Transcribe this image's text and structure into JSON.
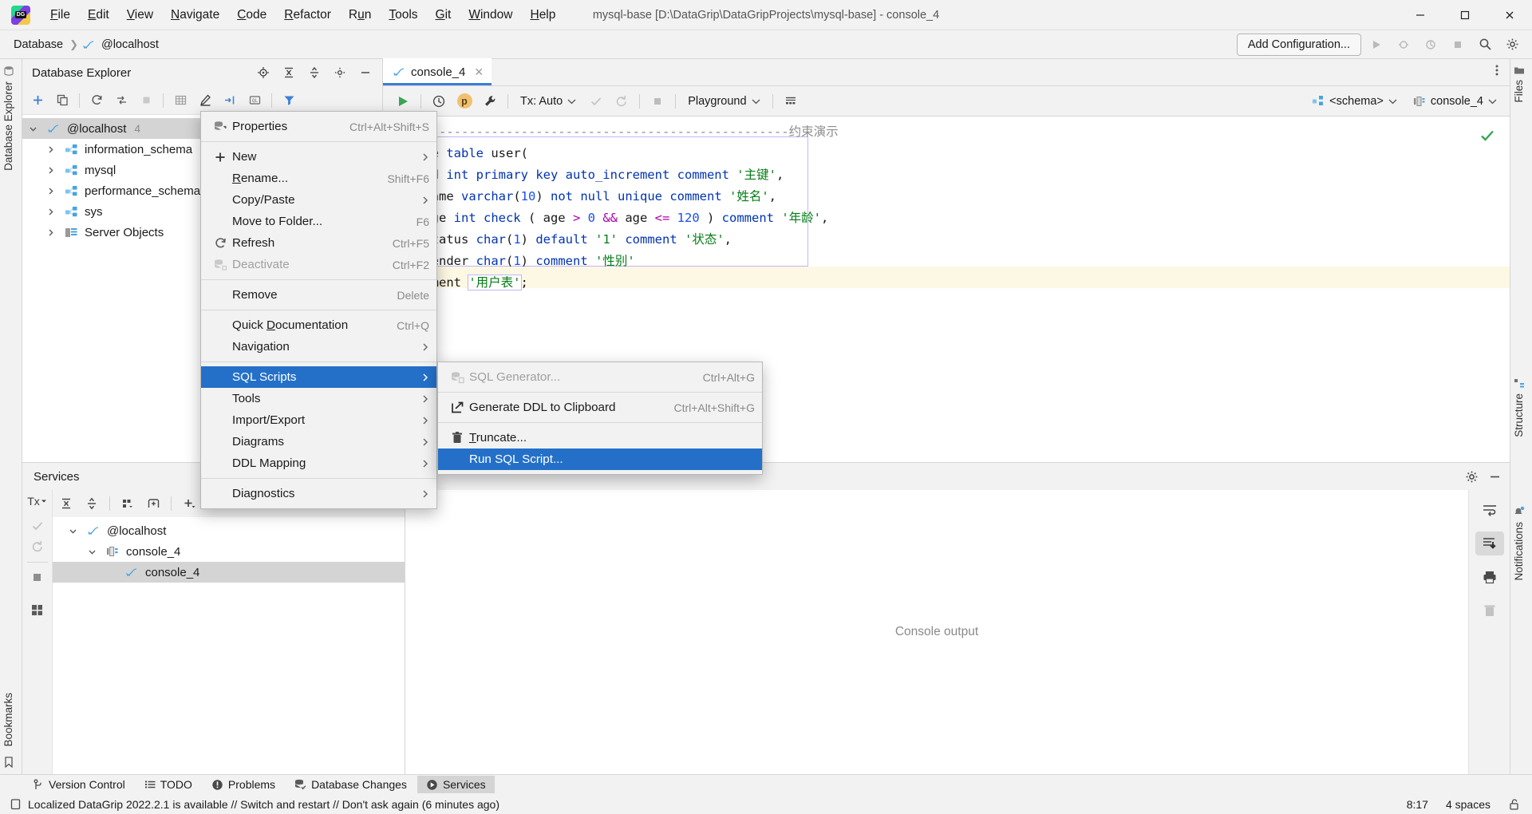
{
  "window": {
    "title": "mysql-base [D:\\DataGrip\\DataGripProjects\\mysql-base] - console_4",
    "minimize": "–",
    "maximize": "▢",
    "close": "✕"
  },
  "menubar": [
    {
      "label": "File"
    },
    {
      "label": "Edit"
    },
    {
      "label": "View"
    },
    {
      "label": "Navigate"
    },
    {
      "label": "Code"
    },
    {
      "label": "Refactor"
    },
    {
      "label": "Run"
    },
    {
      "label": "Tools"
    },
    {
      "label": "Git"
    },
    {
      "label": "Window"
    },
    {
      "label": "Help"
    }
  ],
  "navbar": {
    "crumbs": [
      "Database",
      "@localhost"
    ],
    "separator": "❯",
    "add_configuration": "Add Configuration..."
  },
  "left_strip": {
    "label": "Database Explorer",
    "bookmarks": "Bookmarks"
  },
  "right_strip": {
    "files": "Files",
    "structure": "Structure",
    "notifications": "Notifications"
  },
  "db_explorer": {
    "title": "Database Explorer",
    "tree": [
      {
        "label": "@localhost",
        "badge": "4",
        "icon": "mysql-dolphin-icon",
        "depth": 0,
        "expanded": true,
        "selected": true
      },
      {
        "label": "information_schema",
        "badge": "",
        "icon": "schema-icon",
        "depth": 1,
        "expanded": false,
        "selected": false
      },
      {
        "label": "mysql",
        "badge": "",
        "icon": "schema-icon",
        "depth": 1,
        "expanded": false,
        "selected": false
      },
      {
        "label": "performance_schema",
        "badge": "",
        "icon": "schema-icon",
        "depth": 1,
        "expanded": false,
        "selected": false
      },
      {
        "label": "sys",
        "badge": "",
        "icon": "schema-icon",
        "depth": 1,
        "expanded": false,
        "selected": false
      },
      {
        "label": "Server Objects",
        "badge": "",
        "icon": "server-objects-icon",
        "depth": 1,
        "expanded": false,
        "selected": false
      }
    ]
  },
  "editor": {
    "tab": {
      "label": "console_4",
      "icon": "mysql-dolphin-icon",
      "close": "✕"
    },
    "toolbar": {
      "run": "run-icon",
      "history": "history-icon",
      "profile": "p",
      "wrench": "wrench-icon",
      "tx_label": "Tx: Auto",
      "commit": "commit-icon",
      "rollback": "rollback-icon",
      "stop": "stop-icon",
      "schema_switcher": "Playground",
      "grid_icon": "data-grid-icon",
      "schema_selector": "<schema>",
      "session_selector": "console_4"
    },
    "code_lines": [
      {
        "tokens": [
          {
            "t": "-- --------------------------------------------------约束演示",
            "c": "cmt"
          }
        ]
      },
      {
        "tokens": [
          {
            "t": "create ",
            "c": "kw"
          },
          {
            "t": "table ",
            "c": "kw"
          },
          {
            "t": "user(",
            "c": "plain"
          }
        ]
      },
      {
        "tokens": [
          {
            "t": "    id ",
            "c": "plain"
          },
          {
            "t": "int ",
            "c": "kw"
          },
          {
            "t": "primary ",
            "c": "kw"
          },
          {
            "t": "key ",
            "c": "kw"
          },
          {
            "t": "auto_increment ",
            "c": "kw"
          },
          {
            "t": "comment ",
            "c": "kw"
          },
          {
            "t": "'主键'",
            "c": "str"
          },
          {
            "t": ",",
            "c": "plain"
          }
        ]
      },
      {
        "tokens": [
          {
            "t": "    name ",
            "c": "plain"
          },
          {
            "t": "varchar",
            "c": "kw"
          },
          {
            "t": "(",
            "c": "plain"
          },
          {
            "t": "10",
            "c": "num"
          },
          {
            "t": ") ",
            "c": "plain"
          },
          {
            "t": "not ",
            "c": "kw"
          },
          {
            "t": "null ",
            "c": "kw"
          },
          {
            "t": "unique ",
            "c": "kw"
          },
          {
            "t": "comment ",
            "c": "kw"
          },
          {
            "t": "'姓名'",
            "c": "str"
          },
          {
            "t": ",",
            "c": "plain"
          }
        ]
      },
      {
        "tokens": [
          {
            "t": "    age ",
            "c": "plain"
          },
          {
            "t": "int ",
            "c": "kw"
          },
          {
            "t": "check ",
            "c": "kw"
          },
          {
            "t": "( age ",
            "c": "plain"
          },
          {
            "t": "> ",
            "c": "op"
          },
          {
            "t": "0 ",
            "c": "num"
          },
          {
            "t": "&& ",
            "c": "op"
          },
          {
            "t": "age ",
            "c": "plain"
          },
          {
            "t": "<= ",
            "c": "op"
          },
          {
            "t": "120 ",
            "c": "num"
          },
          {
            "t": ") ",
            "c": "plain"
          },
          {
            "t": "comment ",
            "c": "kw"
          },
          {
            "t": "'年龄'",
            "c": "str"
          },
          {
            "t": ",",
            "c": "plain"
          }
        ]
      },
      {
        "tokens": [
          {
            "t": "    status ",
            "c": "plain"
          },
          {
            "t": "char",
            "c": "kw"
          },
          {
            "t": "(",
            "c": "plain"
          },
          {
            "t": "1",
            "c": "num"
          },
          {
            "t": ") ",
            "c": "plain"
          },
          {
            "t": "default ",
            "c": "kw"
          },
          {
            "t": "'1' ",
            "c": "str"
          },
          {
            "t": "comment ",
            "c": "kw"
          },
          {
            "t": "'状态'",
            "c": "str"
          },
          {
            "t": ",",
            "c": "plain"
          }
        ]
      },
      {
        "tokens": [
          {
            "t": "    gender ",
            "c": "plain"
          },
          {
            "t": "char",
            "c": "kw"
          },
          {
            "t": "(",
            "c": "plain"
          },
          {
            "t": "1",
            "c": "num"
          },
          {
            "t": ") ",
            "c": "plain"
          },
          {
            "t": "comment ",
            "c": "kw"
          },
          {
            "t": "'性别'",
            "c": "str"
          }
        ]
      },
      {
        "tokens": [
          {
            "t": ") comment ",
            "c": "plain"
          },
          {
            "t": "'用户表'",
            "c": "str"
          },
          {
            "t": ";",
            "c": "plain"
          }
        ]
      }
    ]
  },
  "context_menu": [
    {
      "type": "item",
      "label": "Properties",
      "shortcut": "Ctrl+Alt+Shift+S",
      "icon": "properties-icon",
      "arrow": false,
      "disabled": false,
      "highlighted": false
    },
    {
      "type": "separator"
    },
    {
      "type": "item",
      "label": "New",
      "shortcut": "",
      "icon": "plus-icon",
      "arrow": true,
      "disabled": false,
      "highlighted": false
    },
    {
      "type": "item",
      "label": "Rename...",
      "shortcut": "Shift+F6",
      "icon": "",
      "arrow": false,
      "disabled": false,
      "highlighted": false,
      "mnemonic": "R"
    },
    {
      "type": "item",
      "label": "Copy/Paste",
      "shortcut": "",
      "icon": "",
      "arrow": true,
      "disabled": false,
      "highlighted": false
    },
    {
      "type": "item",
      "label": "Move to Folder...",
      "shortcut": "F6",
      "icon": "",
      "arrow": false,
      "disabled": false,
      "highlighted": false
    },
    {
      "type": "item",
      "label": "Refresh",
      "shortcut": "Ctrl+F5",
      "icon": "refresh-icon",
      "arrow": false,
      "disabled": false,
      "highlighted": false
    },
    {
      "type": "item",
      "label": "Deactivate",
      "shortcut": "Ctrl+F2",
      "icon": "deactivate-icon",
      "arrow": false,
      "disabled": true,
      "highlighted": false
    },
    {
      "type": "separator"
    },
    {
      "type": "item",
      "label": "Remove",
      "shortcut": "Delete",
      "icon": "",
      "arrow": false,
      "disabled": false,
      "highlighted": false
    },
    {
      "type": "separator"
    },
    {
      "type": "item",
      "label": "Quick Documentation",
      "shortcut": "Ctrl+Q",
      "icon": "",
      "arrow": false,
      "disabled": false,
      "highlighted": false,
      "mnemonic": "D"
    },
    {
      "type": "item",
      "label": "Navigation",
      "shortcut": "",
      "icon": "",
      "arrow": true,
      "disabled": false,
      "highlighted": false
    },
    {
      "type": "separator"
    },
    {
      "type": "item",
      "label": "SQL Scripts",
      "shortcut": "",
      "icon": "",
      "arrow": true,
      "disabled": false,
      "highlighted": true
    },
    {
      "type": "item",
      "label": "Tools",
      "shortcut": "",
      "icon": "",
      "arrow": true,
      "disabled": false,
      "highlighted": false
    },
    {
      "type": "item",
      "label": "Import/Export",
      "shortcut": "",
      "icon": "",
      "arrow": true,
      "disabled": false,
      "highlighted": false
    },
    {
      "type": "item",
      "label": "Diagrams",
      "shortcut": "",
      "icon": "",
      "arrow": true,
      "disabled": false,
      "highlighted": false
    },
    {
      "type": "item",
      "label": "DDL Mapping",
      "shortcut": "",
      "icon": "",
      "arrow": true,
      "disabled": false,
      "highlighted": false
    },
    {
      "type": "separator"
    },
    {
      "type": "item",
      "label": "Diagnostics",
      "shortcut": "",
      "icon": "",
      "arrow": true,
      "disabled": false,
      "highlighted": false
    }
  ],
  "submenu": [
    {
      "type": "item",
      "label": "SQL Generator...",
      "shortcut": "Ctrl+Alt+G",
      "icon": "sql-generator-icon",
      "disabled": true,
      "highlighted": false
    },
    {
      "type": "separator"
    },
    {
      "type": "item",
      "label": "Generate DDL to Clipboard",
      "shortcut": "Ctrl+Alt+Shift+G",
      "icon": "export-icon",
      "disabled": false,
      "highlighted": false
    },
    {
      "type": "separator"
    },
    {
      "type": "item",
      "label": "Truncate...",
      "shortcut": "",
      "icon": "trash-icon",
      "disabled": false,
      "highlighted": false,
      "mnemonic": "T"
    },
    {
      "type": "item",
      "label": "Run SQL Script...",
      "shortcut": "",
      "icon": "",
      "disabled": false,
      "highlighted": true
    }
  ],
  "services": {
    "title": "Services",
    "tx_label": "Tx",
    "tree": [
      {
        "label": "@localhost",
        "icon": "mysql-dolphin-icon",
        "depth": 0,
        "expanded": true,
        "selected": false
      },
      {
        "label": "console_4",
        "icon": "session-icon",
        "depth": 1,
        "expanded": true,
        "selected": false
      },
      {
        "label": "console_4",
        "icon": "mysql-dolphin-icon",
        "depth": 2,
        "expanded": null,
        "selected": true
      }
    ],
    "console_output_placeholder": "Console output"
  },
  "tool_windows": [
    {
      "label": "Version Control",
      "icon": "branch-icon",
      "active": false
    },
    {
      "label": "TODO",
      "icon": "list-icon",
      "active": false
    },
    {
      "label": "Problems",
      "icon": "warning-icon",
      "active": false
    },
    {
      "label": "Database Changes",
      "icon": "db-changes-icon",
      "active": false
    },
    {
      "label": "Services",
      "icon": "services-icon",
      "active": true
    }
  ],
  "statusbar": {
    "message": "Localized DataGrip 2022.2.1 is available // Switch and restart // Don't ask again (6 minutes ago)",
    "caret_position": "8:17",
    "indent": "4 spaces",
    "lock_icon": "unlocked-icon"
  },
  "colors": {
    "accent": "#2470c9",
    "tab_underline": "#3b7dd8",
    "keyword": "#0033b3",
    "string": "#067d17",
    "number": "#1750eb",
    "operator": "#aa00aa",
    "comment": "#8c8c8c",
    "success": "#3aa552"
  }
}
